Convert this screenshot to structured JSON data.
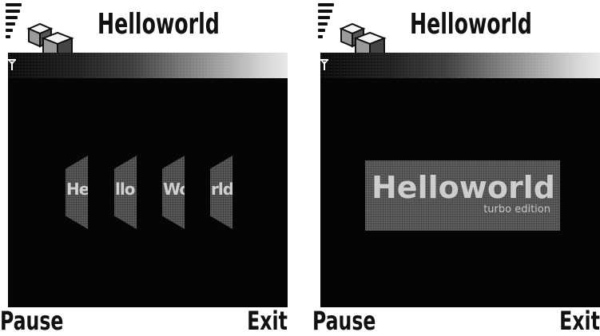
{
  "screens": [
    {
      "title": "Helloworld",
      "left_softkey": "Pause",
      "right_softkey": "Exit",
      "panels": [
        {
          "text": "He",
          "sub": ""
        },
        {
          "text": "llo",
          "sub": ""
        },
        {
          "text": "Wo",
          "sub": ""
        },
        {
          "text": "rld",
          "sub": ""
        }
      ]
    },
    {
      "title": "Helloworld",
      "left_softkey": "Pause",
      "right_softkey": "Exit",
      "banner": {
        "title": "Helloworld",
        "subtitle": "turbo edition"
      }
    }
  ],
  "icons": {
    "app": "cubes-app-icon",
    "signal": "signal-strength-icon",
    "antenna": "antenna-icon"
  },
  "colors": {
    "screen_background": "#050505",
    "text": "#111111",
    "panel": "#5a5a5a",
    "banner_text": "#cdcdcd"
  }
}
